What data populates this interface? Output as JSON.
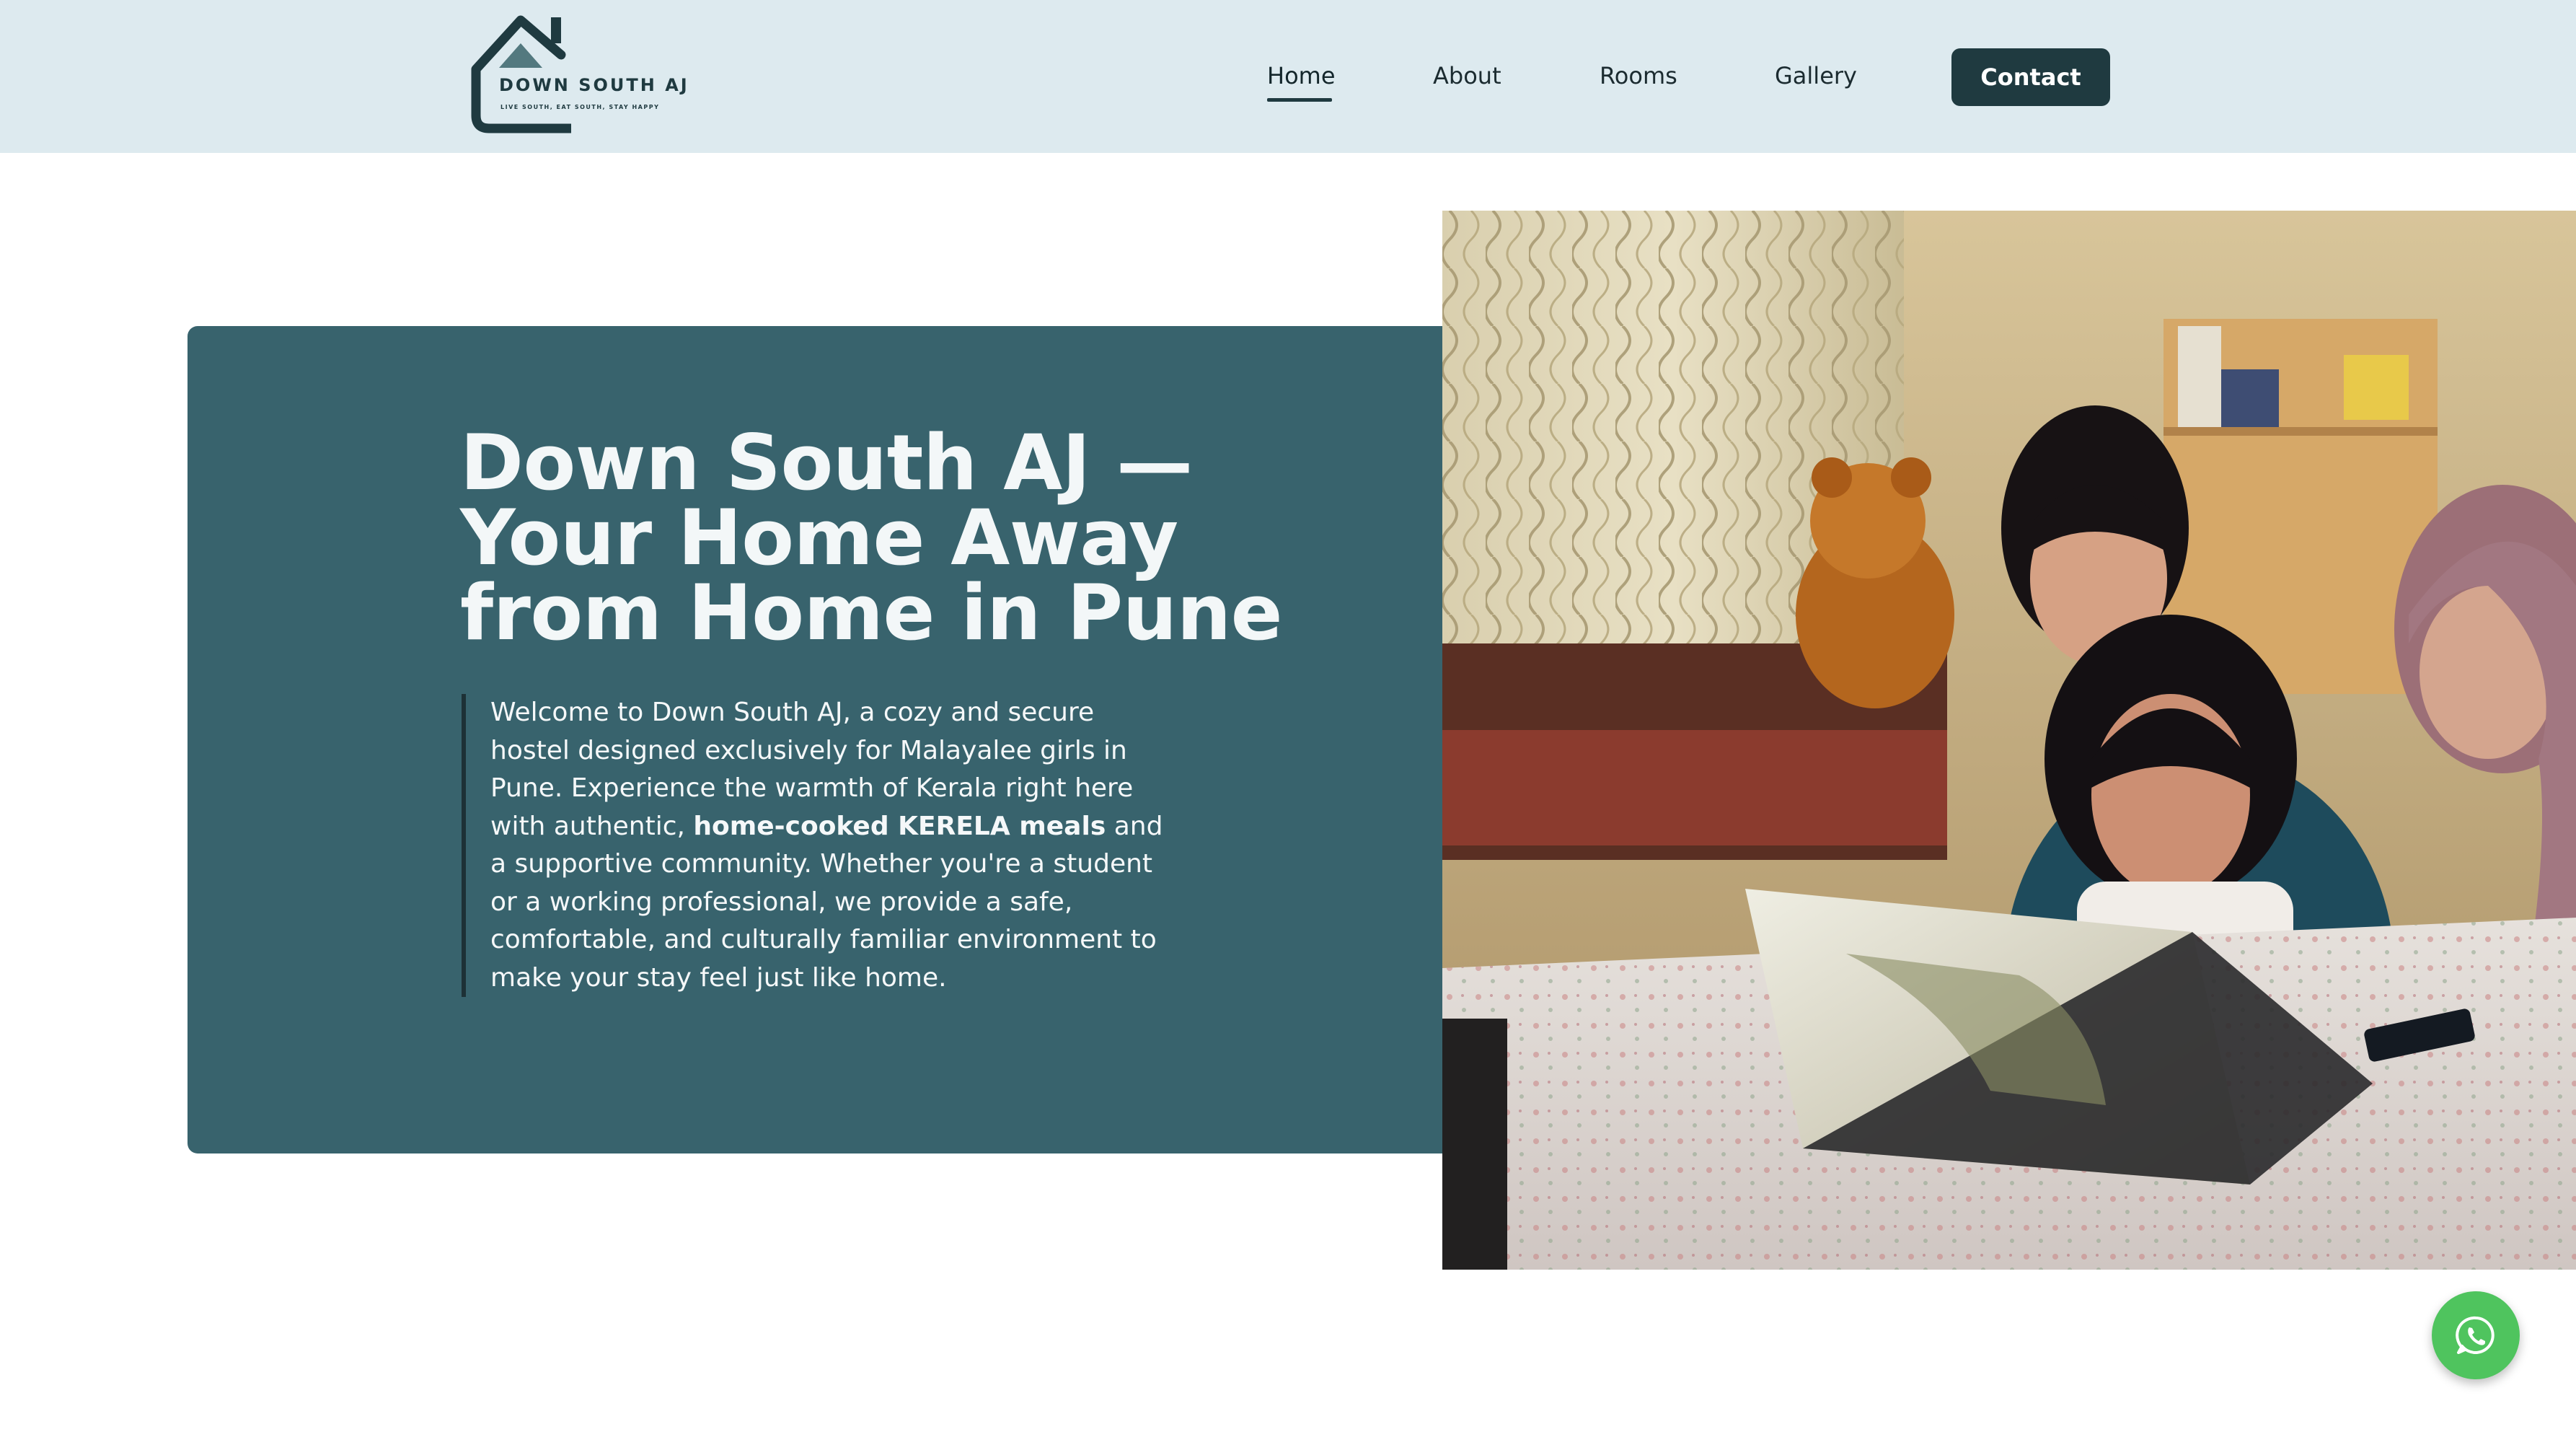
{
  "brand": {
    "name": "DOWN SOUTH AJ",
    "tagline": "LIVE SOUTH, EAT SOUTH, STAY HAPPY",
    "logo_icon": "house-icon",
    "color_primary": "#1f3a40",
    "color_header_bg": "#ddeaef",
    "color_hero_card": "#38636d",
    "color_whatsapp": "#4fc45e"
  },
  "nav": {
    "items": [
      {
        "label": "Home",
        "active": true
      },
      {
        "label": "About",
        "active": false
      },
      {
        "label": "Rooms",
        "active": false
      },
      {
        "label": "Gallery",
        "active": false
      }
    ],
    "contact_label": "Contact"
  },
  "hero": {
    "title": "Down South AJ — Your Home Away from Home in Pune",
    "text_before": "Welcome to Down South AJ, a cozy and secure hostel designed exclusively for Malayalee girls in Pune. Experience the warmth of Kerala right here with authentic, ",
    "text_bold": "home-cooked KERELA meals",
    "text_after": " and a supportive community. Whether you're a student or a working professional, we provide a safe, comfortable, and culturally familiar environment to make your stay feel just like home."
  },
  "floating": {
    "whatsapp_icon": "whatsapp-icon"
  }
}
